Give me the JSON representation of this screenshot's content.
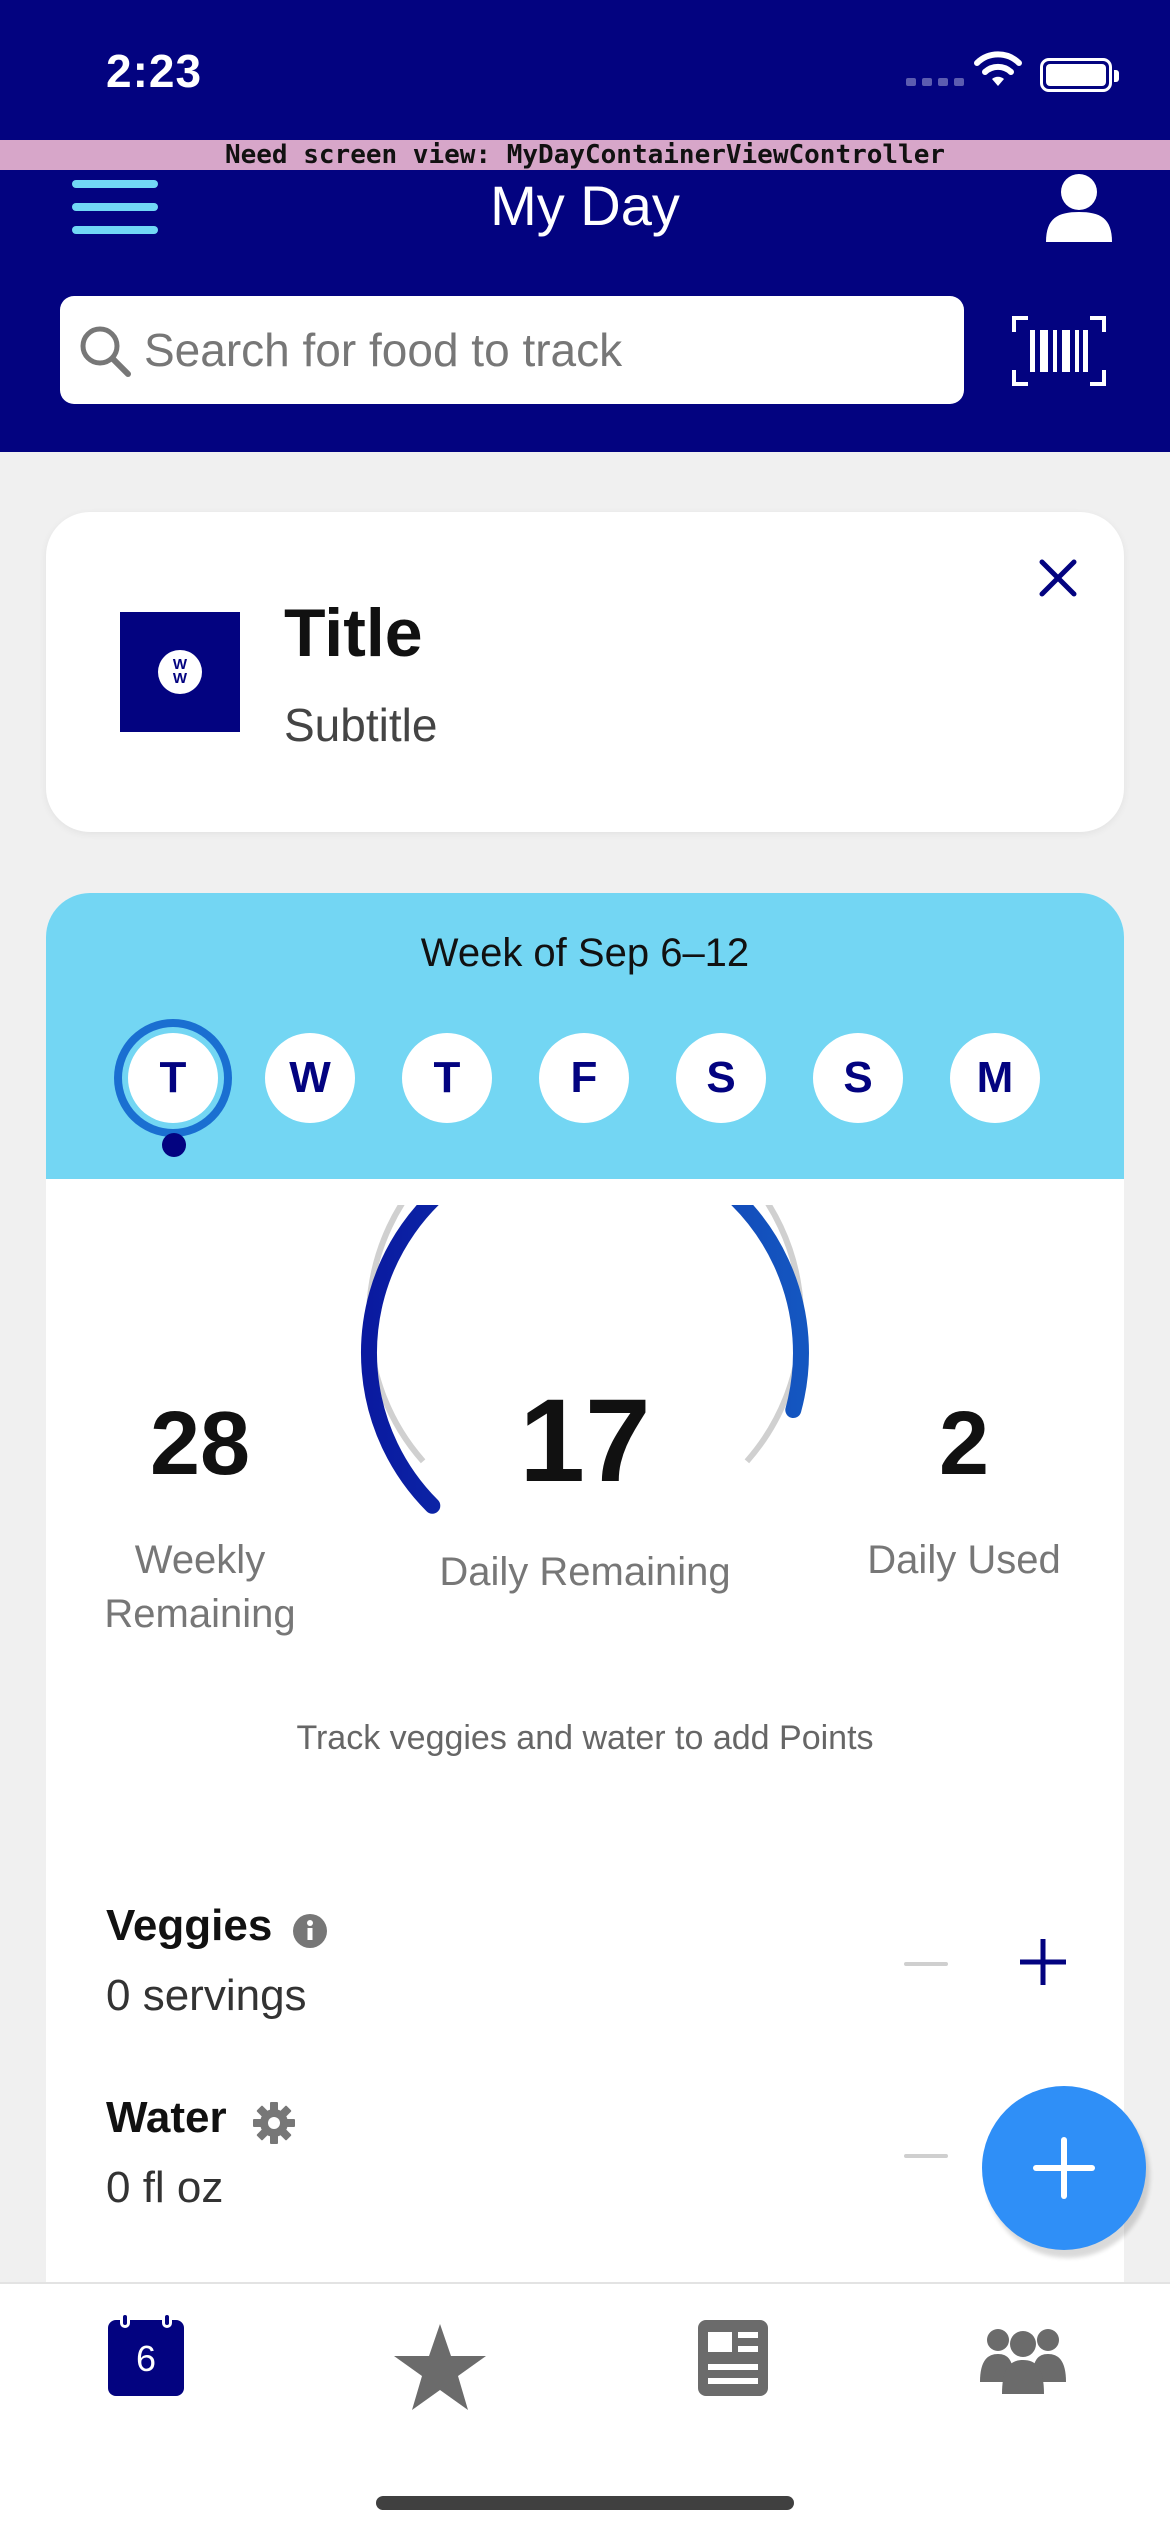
{
  "status_bar": {
    "time": "2:23"
  },
  "debug_banner": "Need screen view: MyDayContainerViewController",
  "header": {
    "title": "My Day",
    "search_placeholder": "Search for food to track"
  },
  "promo": {
    "title": "Title",
    "subtitle": "Subtitle",
    "logo_text": "WW"
  },
  "week": {
    "label": "Week of Sep 6–12",
    "days": [
      "T",
      "W",
      "T",
      "F",
      "S",
      "S",
      "M"
    ],
    "selected_index": 0
  },
  "points": {
    "weekly_remaining": "28",
    "weekly_label": "Weekly Remaining",
    "daily_remaining": "17",
    "daily_remaining_label": "Daily Remaining",
    "daily_used": "2",
    "daily_used_label": "Daily Used",
    "gauge_fraction": 0.89
  },
  "hint": "Track veggies and water to add Points",
  "veggies": {
    "title": "Veggies",
    "value": "0 servings"
  },
  "water": {
    "title": "Water",
    "value": "0 fl oz"
  },
  "bottom_nav": {
    "calendar_day": "6",
    "items": [
      "my-day",
      "favorites",
      "articles",
      "community"
    ]
  },
  "colors": {
    "brand_navy": "#030380",
    "accent_cyan": "#73d6f3",
    "fab_blue": "#2f8ff7"
  }
}
